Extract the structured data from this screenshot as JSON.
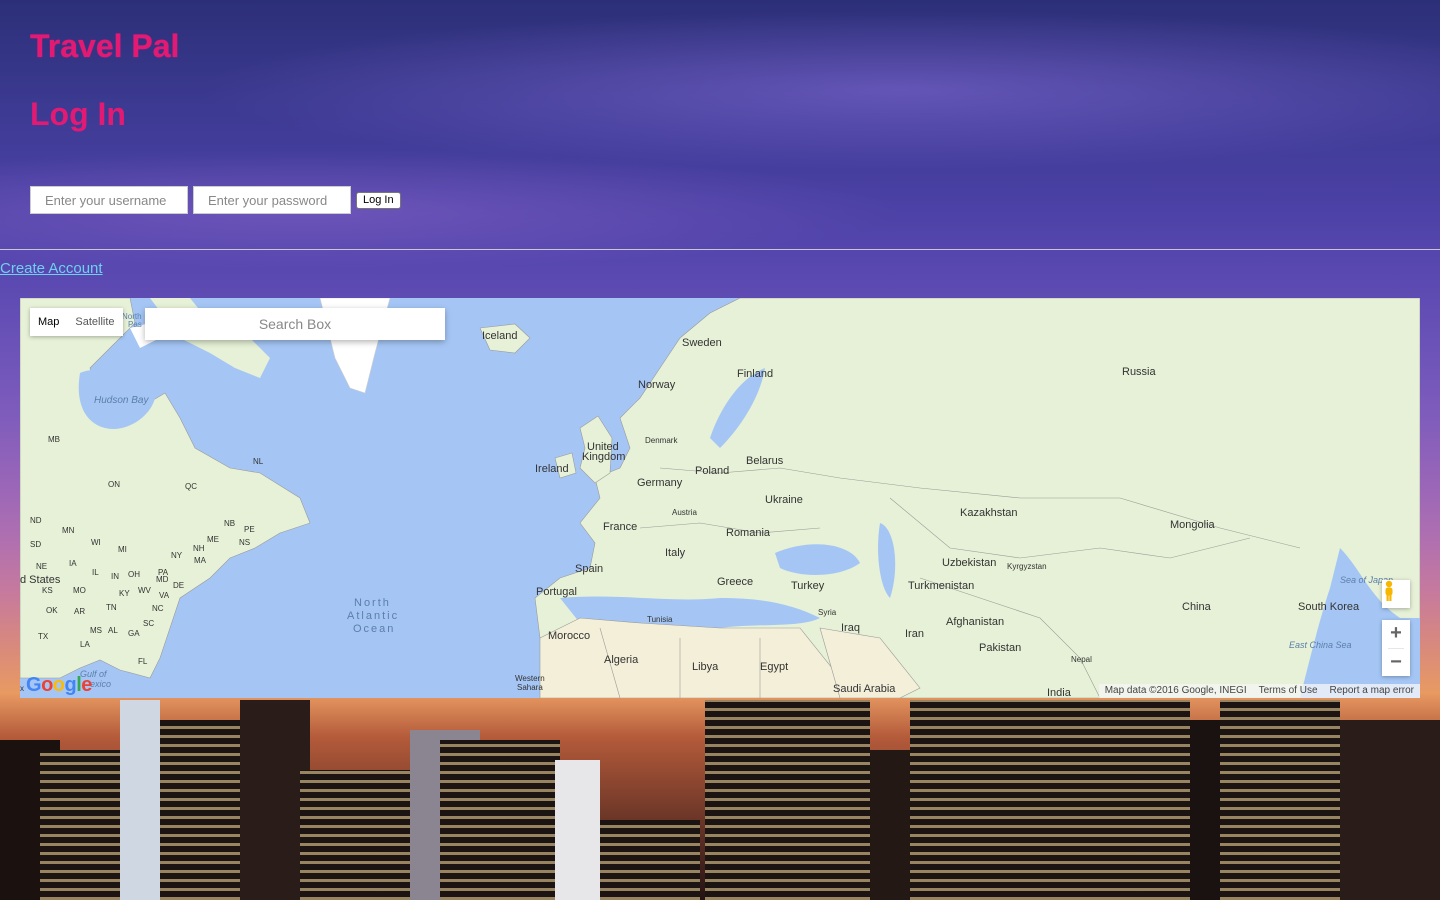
{
  "app": {
    "title": "Travel Pal"
  },
  "login": {
    "heading": "Log In",
    "username_placeholder": "Enter your username",
    "password_placeholder": "Enter your password",
    "submit_label": "Log In"
  },
  "create_account_label": "Create Account",
  "map": {
    "type_options": [
      "Map",
      "Satellite"
    ],
    "selected_type": "Map",
    "search_placeholder": "Search Box",
    "zoom_in": "+",
    "zoom_out": "−",
    "logo": "Google",
    "attribution": {
      "data": "Map data ©2016 Google, INEGI",
      "terms": "Terms of Use",
      "report": "Report a map error"
    },
    "labels": {
      "iceland": "Iceland",
      "sweden": "Sweden",
      "finland": "Finland",
      "norway": "Norway",
      "russia": "Russia",
      "hudson_bay": "Hudson Bay",
      "united_kingdom_1": "United",
      "united_kingdom_2": "Kingdom",
      "denmark": "Denmark",
      "ireland": "Ireland",
      "belarus": "Belarus",
      "poland": "Poland",
      "germany": "Germany",
      "ukraine": "Ukraine",
      "kazakhstan": "Kazakhstan",
      "austria": "Austria",
      "mongolia": "Mongolia",
      "france": "France",
      "romania": "Romania",
      "italy": "Italy",
      "uzbekistan": "Uzbekistan",
      "kyrgyzstan": "Kyrgyzstan",
      "spain": "Spain",
      "greece": "Greece",
      "turkey": "Turkey",
      "turkmenistan": "Turkmenistan",
      "portugal": "Portugal",
      "syria": "Syria",
      "china": "China",
      "south_korea": "South Korea",
      "sea_of_japan": "Sea of Japan",
      "north_atlantic_1": "North",
      "north_atlantic_2": "Atlantic",
      "north_atlantic_3": "Ocean",
      "tunisia": "Tunisia",
      "iraq": "Iraq",
      "iran": "Iran",
      "afghanistan": "Afghanistan",
      "morocco": "Morocco",
      "pakistan": "Pakistan",
      "east_china_sea": "East China Sea",
      "algeria": "Algeria",
      "libya": "Libya",
      "egypt": "Egypt",
      "nepal": "Nepal",
      "western_sahara_1": "Western",
      "western_sahara_2": "Sahara",
      "saudi_arabia": "Saudi Arabia",
      "india": "India",
      "gulf_of_mexico": "Gulf of",
      "gulf_of_mexico_2": "exico",
      "united_states": "d States",
      "mb": "MB",
      "on": "ON",
      "qc": "QC",
      "nl": "NL",
      "nd": "ND",
      "mn": "MN",
      "wi": "WI",
      "mi": "MI",
      "sd": "SD",
      "ne": "NE",
      "ia": "IA",
      "il": "IL",
      "in": "IN",
      "oh": "OH",
      "pa": "PA",
      "ny": "NY",
      "nh": "NH",
      "me": "ME",
      "nb": "NB",
      "pe": "PE",
      "ns": "NS",
      "ma": "MA",
      "wv": "WV",
      "va": "VA",
      "md": "MD",
      "de": "DE",
      "ks": "KS",
      "mo": "MO",
      "ky": "KY",
      "ok": "OK",
      "ar": "AR",
      "tn": "TN",
      "nc": "NC",
      "sc": "SC",
      "ga": "GA",
      "al": "AL",
      "ms": "MS",
      "la": "LA",
      "tx": "TX",
      "fl": "FL",
      "north_pass_1": "North",
      "north_pass_2": "Pas",
      "x": "x"
    }
  }
}
